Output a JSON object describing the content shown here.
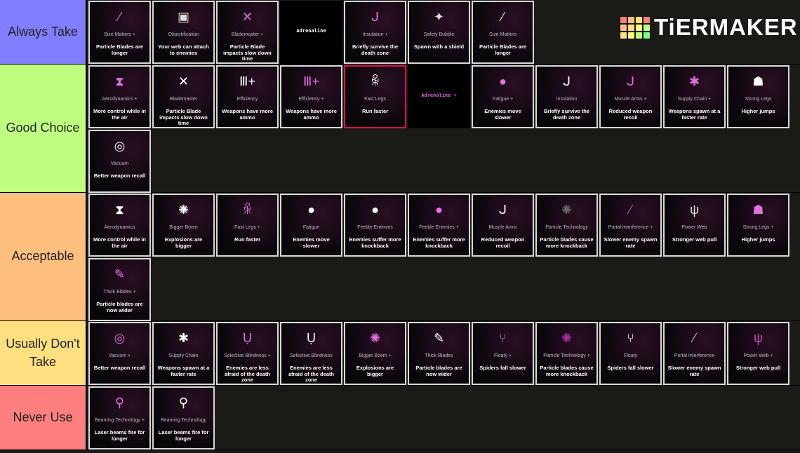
{
  "logo": {
    "text": "TiERMAKER",
    "colors": [
      "#ff7f7f",
      "#ffbf7f",
      "#ffdf7f",
      "#ff7f7f",
      "#ffbf7f",
      "#ffdf7f",
      "#ffff7f",
      "#bfff7f",
      "#ffdf7f",
      "#ffff7f",
      "#bfff7f",
      "#7fff7f"
    ]
  },
  "tiers": [
    {
      "label": "Always Take",
      "color": "#7f7fff",
      "cards": [
        {
          "title": "Size Matters +",
          "desc": "Particle Blades are longer",
          "icon": "⁄",
          "icon_name": "blade-icon",
          "icon_color": "#e070e0"
        },
        {
          "title": "Objectification",
          "desc": "Your web can attach to enemies",
          "icon": "▣",
          "icon_name": "object-icon",
          "icon_color": "#ddd"
        },
        {
          "title": "Blademaster +",
          "desc": "Particle Blade impacts slow down time",
          "icon": "✕",
          "icon_name": "cross-blades-icon",
          "icon_color": "#e070e0"
        },
        {
          "title": "Adrenaline",
          "desc": "",
          "variant": "plain"
        },
        {
          "title": "Insulation +",
          "desc": "Briefly survive the death zone",
          "icon": "ᒍ",
          "icon_name": "insulation-icon",
          "icon_color": "#e070e0"
        },
        {
          "title": "Safety Bubble",
          "desc": "Spawn with a shield",
          "icon": "✦",
          "icon_name": "bubble-icon",
          "icon_color": "#ddd"
        },
        {
          "title": "Size Matters",
          "desc": "Particle Blades are longer",
          "icon": "⁄",
          "icon_name": "blade-icon",
          "icon_color": "#ddd"
        }
      ]
    },
    {
      "label": "Good Choice",
      "color": "#bfff7f",
      "cards": [
        {
          "title": "Aerodynamics +",
          "desc": "More control while in the air",
          "icon": "⧗",
          "icon_name": "aerodynamics-icon",
          "icon_color": "#e070e0"
        },
        {
          "title": "Blademaster",
          "desc": "Particle Blade impacts slow down time",
          "icon": "✕",
          "icon_name": "cross-blades-icon",
          "icon_color": "#fff"
        },
        {
          "title": "Efficiency",
          "desc": "Weapons have more ammo",
          "icon": "Ⅲ+",
          "icon_name": "ammo-icon",
          "icon_color": "#fff"
        },
        {
          "title": "Efficiency +",
          "desc": "Weapons have more ammo",
          "icon": "Ⅲ+",
          "icon_name": "ammo-icon",
          "icon_color": "#e070e0"
        },
        {
          "title": "Fast Legs",
          "desc": "Run faster",
          "icon": "ꆜ",
          "icon_name": "legs-icon",
          "icon_color": "#fff",
          "variant": "red"
        },
        {
          "title": "Adrenaline +",
          "desc": "",
          "variant": "plain",
          "title_color": "#d060d0"
        },
        {
          "title": "Fatigue +",
          "desc": "Enemies move slower",
          "icon": "●",
          "icon_name": "snail-icon",
          "icon_color": "#e070e0"
        },
        {
          "title": "Insulation",
          "desc": "Briefly survive the death zone",
          "icon": "ᒍ",
          "icon_name": "insulation-icon",
          "icon_color": "#fff"
        },
        {
          "title": "Muscle Arms +",
          "desc": "Reduced weapon recoil",
          "icon": "ᒍ",
          "icon_name": "arm-icon",
          "icon_color": "#e070e0"
        },
        {
          "title": "Supply Chain +",
          "desc": "Weapons spawn at a faster rate",
          "icon": "✱",
          "icon_name": "supply-icon",
          "icon_color": "#e070e0"
        },
        {
          "title": "Strong Legs",
          "desc": "Higher jumps",
          "icon": "☗",
          "icon_name": "spider-icon",
          "icon_color": "#fff"
        },
        {
          "title": "Vacuum",
          "desc": "Better weapon recall",
          "icon": "◎",
          "icon_name": "vacuum-icon",
          "icon_color": "#fff"
        }
      ]
    },
    {
      "label": "Acceptable",
      "color": "#ffbf7f",
      "cards": [
        {
          "title": "Aerodynamics",
          "desc": "More control while in the air",
          "icon": "⧗",
          "icon_name": "aerodynamics-icon",
          "icon_color": "#fff"
        },
        {
          "title": "Bigger Boom",
          "desc": "Explosions are bigger",
          "icon": "✺",
          "icon_name": "explosion-icon",
          "icon_color": "#fff"
        },
        {
          "title": "Fast Legs +",
          "desc": "Run faster",
          "icon": "ꆜ",
          "icon_name": "legs-icon",
          "icon_color": "#e070e0"
        },
        {
          "title": "Fatigue",
          "desc": "Enemies move slower",
          "icon": "●",
          "icon_name": "snail-icon",
          "icon_color": "#fff"
        },
        {
          "title": "Feeble Enemies",
          "desc": "Enemies suffer more knockback",
          "icon": "●",
          "icon_name": "face-icon",
          "icon_color": "#fff"
        },
        {
          "title": "Feeble Enemies +",
          "desc": "Enemies suffer more knockback",
          "icon": "●",
          "icon_name": "face-icon",
          "icon_color": "#f070f0"
        },
        {
          "title": "Muscle Arms",
          "desc": "Reduced weapon recoil",
          "icon": "ᒍ",
          "icon_name": "arm-icon",
          "icon_color": "#fff"
        },
        {
          "title": "Particle Technology",
          "desc": "Particle blades cause more knockback",
          "icon": "✺",
          "icon_name": "particle-icon",
          "icon_color": "#666"
        },
        {
          "title": "Portal Interference +",
          "desc": "Slower enemy spawn rate",
          "icon": "⁄",
          "icon_name": "portal-icon",
          "icon_color": "#c050c0"
        },
        {
          "title": "Power Web",
          "desc": "Stronger web pull",
          "icon": "ψ",
          "icon_name": "web-icon",
          "icon_color": "#ddd"
        },
        {
          "title": "Strong Legs +",
          "desc": "Higher jumps",
          "icon": "☗",
          "icon_name": "spider-icon",
          "icon_color": "#e070e0"
        },
        {
          "title": "Thick Blades +",
          "desc": "Particle blades are now wider",
          "icon": "✎",
          "icon_name": "thick-blade-icon",
          "icon_color": "#f070f0"
        }
      ]
    },
    {
      "label": "Usually Don't Take",
      "color": "#ffdf7f",
      "cards": [
        {
          "title": "Vacuum +",
          "desc": "Better weapon recall",
          "icon": "◎",
          "icon_name": "vacuum-icon",
          "icon_color": "#e070e0"
        },
        {
          "title": "Supply Chain",
          "desc": "Weapons spawn at a faster rate",
          "icon": "✱",
          "icon_name": "supply-icon",
          "icon_color": "#fff"
        },
        {
          "title": "Selective Blindness +",
          "desc": "Enemies are less afraid of the death zone",
          "icon": "Ụ",
          "icon_name": "blindness-icon",
          "icon_color": "#e070e0"
        },
        {
          "title": "Selective Blindness",
          "desc": "Enemies are less afraid of the death zone",
          "icon": "Ụ",
          "icon_name": "blindness-icon",
          "icon_color": "#fff"
        },
        {
          "title": "Bigger Boom +",
          "desc": "Explosions are bigger",
          "icon": "✺",
          "icon_name": "explosion-icon",
          "icon_color": "#e070e0"
        },
        {
          "title": "Thick Blades",
          "desc": "Particle blades are now wider",
          "icon": "✎",
          "icon_name": "thick-blade-icon",
          "icon_color": "#fff"
        },
        {
          "title": "Floaty +",
          "desc": "Spiders fall slower",
          "icon": "⑂",
          "icon_name": "floaty-icon",
          "icon_color": "#e070e0"
        },
        {
          "title": "Particle Technology +",
          "desc": "Particle blades cause more knockback",
          "icon": "✺",
          "icon_name": "particle-icon",
          "icon_color": "#a030a0"
        },
        {
          "title": "Floaty",
          "desc": "Spiders fall slower",
          "icon": "⑂",
          "icon_name": "floaty-icon",
          "icon_color": "#fff"
        },
        {
          "title": "Portal Interference",
          "desc": "Slower enemy spawn rate",
          "icon": "⁄",
          "icon_name": "portal-icon",
          "icon_color": "#bbb"
        },
        {
          "title": "Power Web +",
          "desc": "Stronger web pull",
          "icon": "ψ",
          "icon_name": "web-icon",
          "icon_color": "#c050c0"
        }
      ]
    },
    {
      "label": "Never Use",
      "color": "#ff7f7f",
      "cards": [
        {
          "title": "Beaming Technology +",
          "desc": "Laser beams fire for longer",
          "icon": "⚲",
          "icon_name": "laser-icon",
          "icon_color": "#e070e0"
        },
        {
          "title": "Beaming Technology",
          "desc": "Laser beams fire for longer",
          "icon": "⚲",
          "icon_name": "laser-icon",
          "icon_color": "#fff"
        }
      ]
    }
  ]
}
